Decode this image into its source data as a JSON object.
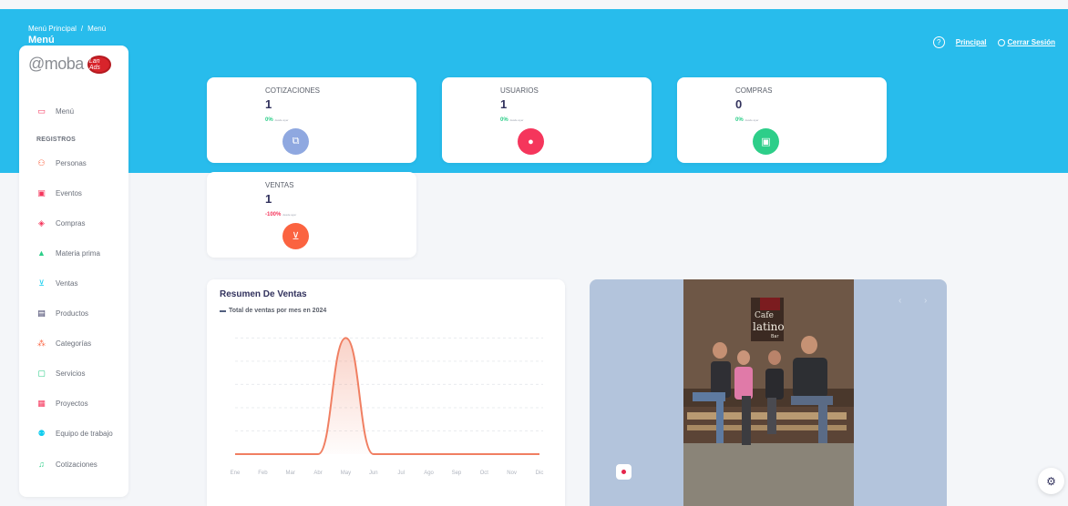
{
  "breadcrumb": {
    "root": "Menú Principal",
    "separator": "/",
    "current": "Menú"
  },
  "page_title": "Menú",
  "top_links": {
    "help_icon": "?",
    "principal": "Principal",
    "logout": "Cerrar Sesión"
  },
  "logo": {
    "word": "moba",
    "badge": "Lan Ads"
  },
  "sidebar": {
    "section": "REGISTROS",
    "items": [
      {
        "label": "Menú",
        "icon": "monitor-icon"
      },
      {
        "label": "Personas",
        "icon": "users-icon"
      },
      {
        "label": "Eventos",
        "icon": "calendar-icon"
      },
      {
        "label": "Compras",
        "icon": "box-icon"
      },
      {
        "label": "Materia prima",
        "icon": "tree-icon"
      },
      {
        "label": "Ventas",
        "icon": "cart-icon"
      },
      {
        "label": "Productos",
        "icon": "basket-icon"
      },
      {
        "label": "Categorías",
        "icon": "sitemap-icon"
      },
      {
        "label": "Servicios",
        "icon": "clipboard-icon"
      },
      {
        "label": "Proyectos",
        "icon": "calendar-grid-icon"
      },
      {
        "label": "Equipo de trabajo",
        "icon": "team-icon"
      },
      {
        "label": "Cotizaciones",
        "icon": "bell-icon"
      }
    ]
  },
  "stats": [
    {
      "label": "COTIZACIONES",
      "value": "1",
      "trend": "0%",
      "since": "desde ayer",
      "color": "#8fa8e0",
      "trend_color": "#2dce89"
    },
    {
      "label": "USUARIOS",
      "value": "1",
      "trend": "0%",
      "since": "desde ayer",
      "color": "#f5365c",
      "trend_color": "#2dce89"
    },
    {
      "label": "COMPRAS",
      "value": "0",
      "trend": "0%",
      "since": "desde ayer",
      "color": "#2dce89",
      "trend_color": "#2dce89"
    },
    {
      "label": "VENTAS",
      "value": "1",
      "trend": "-100%",
      "since": "desde ayer",
      "color": "#fb6340",
      "trend_color": "#f5365c"
    }
  ],
  "chart_data": {
    "type": "area",
    "title": "Resumen De Ventas",
    "series": [
      {
        "name": "Total de ventas por mes en 2024",
        "values": [
          0,
          0,
          0,
          0,
          1,
          0,
          0,
          0,
          0,
          0,
          0,
          0
        ]
      }
    ],
    "categories": [
      "Ene",
      "Feb",
      "Mar",
      "Abr",
      "May",
      "Jun",
      "Jul",
      "Ago",
      "Sep",
      "Oct",
      "Nov",
      "Dic"
    ],
    "ylim": [
      0,
      1.05
    ],
    "grid": true,
    "line_color": "#f07f62"
  },
  "carousel": {
    "prev": "‹",
    "next": "›",
    "sign_text": "Cafe latino Bar"
  }
}
